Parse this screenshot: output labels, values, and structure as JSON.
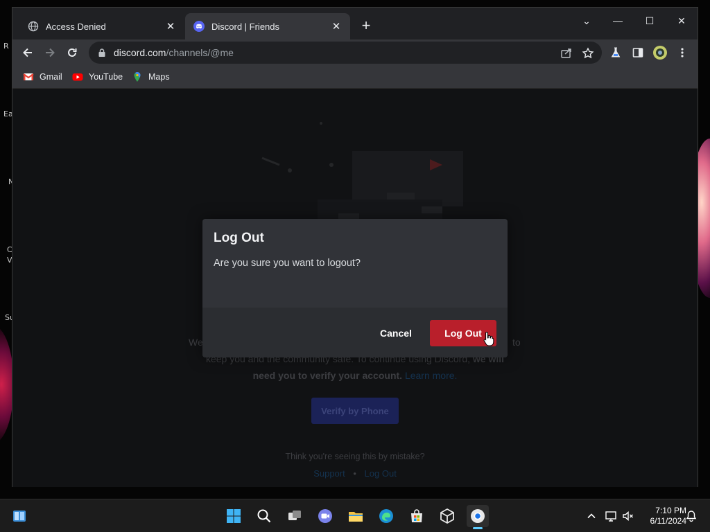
{
  "desktop": {
    "fragments": [
      "R",
      "Ea",
      "N",
      "C",
      "V",
      "Su"
    ]
  },
  "browser": {
    "tabs": [
      {
        "title": "Access Denied",
        "icon": "globe-icon",
        "active": false
      },
      {
        "title": "Discord | Friends",
        "icon": "discord-icon",
        "active": true
      }
    ],
    "new_tab_label": "+",
    "window_controls": {
      "tab_search": "⌄",
      "minimize": "—",
      "maximize": "☐",
      "close": "✕"
    },
    "address": {
      "domain": "discord.com",
      "path": "/channels/@me"
    },
    "bookmarks": [
      {
        "label": "Gmail",
        "icon": "gmail-icon"
      },
      {
        "label": "YouTube",
        "icon": "youtube-icon"
      },
      {
        "label": "Maps",
        "icon": "maps-icon"
      }
    ]
  },
  "page": {
    "background_text": {
      "line1_prefix": "We",
      "line1_suffix": "to",
      "line2": "keep you and the community safe. To continue using Discord,",
      "line2_bold": "we will",
      "line3_bold": "need you to verify your account.",
      "line3_link": "Learn more.",
      "verify_button": "Verify by Phone",
      "mistake_text": "Think you're seeing this by mistake?",
      "support_link": "Support",
      "separator": "•",
      "logout_link": "Log Out"
    },
    "modal": {
      "title": "Log Out",
      "message": "Are you sure you want to logout?",
      "cancel_label": "Cancel",
      "confirm_label": "Log Out"
    }
  },
  "taskbar": {
    "apps": [
      "windows-start",
      "search",
      "task-view",
      "teams-chat",
      "file-explorer",
      "edge",
      "microsoft-store",
      "virtualbox",
      "chrome"
    ],
    "clock_time": "7:10 PM",
    "clock_date": "6/11/2024"
  },
  "colors": {
    "discord_blurple": "#5865f2",
    "danger_red": "#b91f2b",
    "modal_bg": "#313338",
    "modal_footer_bg": "#2b2d31"
  }
}
